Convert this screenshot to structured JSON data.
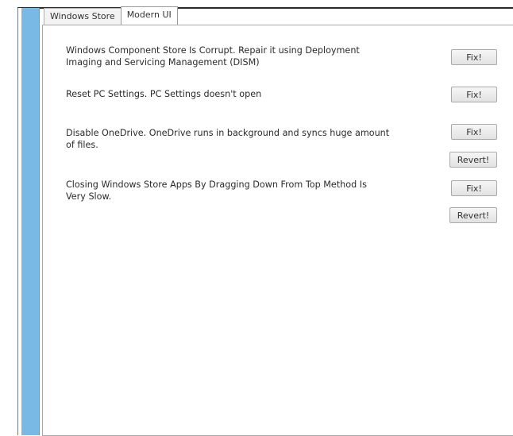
{
  "tabs": [
    {
      "label": "Windows Store"
    },
    {
      "label": "Modern UI"
    }
  ],
  "items": [
    {
      "text": "Windows Component Store Is Corrupt. Repair it using Deployment\nImaging and Servicing Management (DISM)",
      "fix_label": "Fix!"
    },
    {
      "text": "Reset PC Settings. PC Settings doesn't open",
      "fix_label": "Fix!"
    },
    {
      "text": "Disable OneDrive. OneDrive runs in background and syncs huge amount\nof files.",
      "fix_label": "Fix!",
      "revert_label": "Revert!"
    },
    {
      "text": "Closing Windows Store Apps By Dragging Down From Top Method Is\nVery Slow.",
      "fix_label": "Fix!",
      "revert_label": "Revert!"
    }
  ],
  "colors": {
    "sidebar_blue": "#79b9e6"
  }
}
